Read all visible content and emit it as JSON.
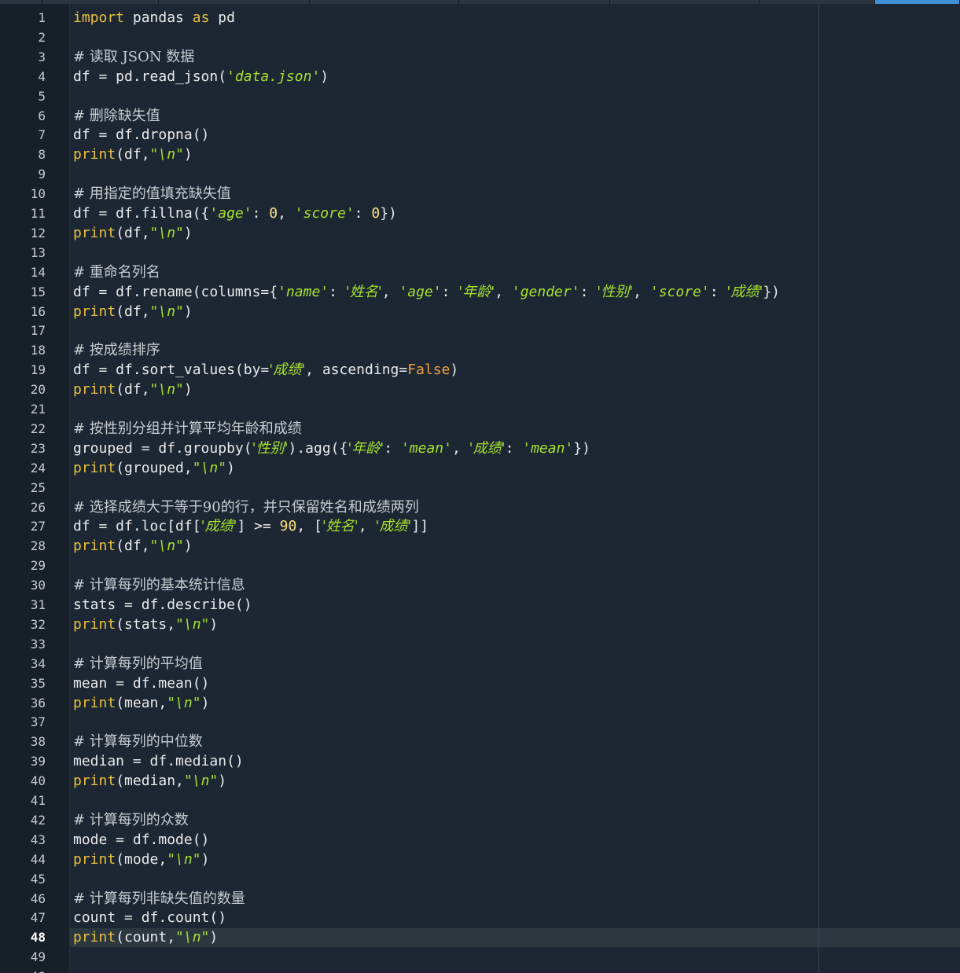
{
  "editor": {
    "current_line_label": "48",
    "gutter_numbers": [
      "1",
      "2",
      "3",
      "4",
      "5",
      "6",
      "7",
      "8",
      "9",
      "10",
      "11",
      "12",
      "13",
      "14",
      "15",
      "16",
      "17",
      "18",
      "19",
      "20",
      "21",
      "22",
      "23",
      "24",
      "25",
      "26",
      "27",
      "28",
      "29",
      "30",
      "31",
      "32",
      "33",
      "34",
      "35",
      "36",
      "37",
      "38",
      "39",
      "40",
      "41",
      "42",
      "43",
      "44",
      "45",
      "46",
      "47",
      "48",
      "49",
      "48"
    ],
    "colors": {
      "background": "#1c2733",
      "gutter": "#172029",
      "keyword": "#e8c040",
      "string": "#a6e22e",
      "comment": "#c8ccd0",
      "bool": "#f0a040",
      "current_line": "#2c3740"
    },
    "lines": [
      [
        [
          "kw",
          "import"
        ],
        [
          "p",
          " pandas "
        ],
        [
          "kw",
          "as"
        ],
        [
          "p",
          " pd"
        ]
      ],
      [],
      [
        [
          "com",
          "# 读取 JSON 数据"
        ]
      ],
      [
        [
          "p",
          "df = pd.read_json("
        ],
        [
          "str",
          "'data.json'"
        ],
        [
          "p",
          ")"
        ]
      ],
      [],
      [
        [
          "com",
          "# 删除缺失值"
        ]
      ],
      [
        [
          "p",
          "df = df.dropna()"
        ]
      ],
      [
        [
          "kw",
          "print"
        ],
        [
          "p",
          "(df,"
        ],
        [
          "str",
          "\"\\n\""
        ],
        [
          "p",
          ")"
        ]
      ],
      [],
      [
        [
          "com",
          "# 用指定的值填充缺失值"
        ]
      ],
      [
        [
          "p",
          "df = df.fillna({"
        ],
        [
          "str",
          "'age'"
        ],
        [
          "p",
          ": "
        ],
        [
          "num",
          "0"
        ],
        [
          "p",
          ", "
        ],
        [
          "str",
          "'score'"
        ],
        [
          "p",
          ": "
        ],
        [
          "num",
          "0"
        ],
        [
          "p",
          "})"
        ]
      ],
      [
        [
          "kw",
          "print"
        ],
        [
          "p",
          "(df,"
        ],
        [
          "str",
          "\"\\n\""
        ],
        [
          "p",
          ")"
        ]
      ],
      [],
      [
        [
          "com",
          "# 重命名列名"
        ]
      ],
      [
        [
          "p",
          "df = df.rename(columns={"
        ],
        [
          "str",
          "'name'"
        ],
        [
          "p",
          ": "
        ],
        [
          "str",
          "'姓名'"
        ],
        [
          "p",
          ", "
        ],
        [
          "str",
          "'age'"
        ],
        [
          "p",
          ": "
        ],
        [
          "str",
          "'年龄'"
        ],
        [
          "p",
          ", "
        ],
        [
          "str",
          "'gender'"
        ],
        [
          "p",
          ": "
        ],
        [
          "str",
          "'性别'"
        ],
        [
          "p",
          ", "
        ],
        [
          "str",
          "'score'"
        ],
        [
          "p",
          ": "
        ],
        [
          "str",
          "'成绩'"
        ],
        [
          "p",
          "})"
        ]
      ],
      [
        [
          "kw",
          "print"
        ],
        [
          "p",
          "(df,"
        ],
        [
          "str",
          "\"\\n\""
        ],
        [
          "p",
          ")"
        ]
      ],
      [],
      [
        [
          "com",
          "# 按成绩排序"
        ]
      ],
      [
        [
          "p",
          "df = df.sort_values(by="
        ],
        [
          "str",
          "'成绩'"
        ],
        [
          "p",
          ", ascending="
        ],
        [
          "bool",
          "False"
        ],
        [
          "p",
          ")"
        ]
      ],
      [
        [
          "kw",
          "print"
        ],
        [
          "p",
          "(df,"
        ],
        [
          "str",
          "\"\\n\""
        ],
        [
          "p",
          ")"
        ]
      ],
      [],
      [
        [
          "com",
          "# 按性别分组并计算平均年龄和成绩"
        ]
      ],
      [
        [
          "p",
          "grouped = df.groupby("
        ],
        [
          "str",
          "'性别'"
        ],
        [
          "p",
          ").agg({"
        ],
        [
          "str",
          "'年龄'"
        ],
        [
          "p",
          ": "
        ],
        [
          "str",
          "'mean'"
        ],
        [
          "p",
          ", "
        ],
        [
          "str",
          "'成绩'"
        ],
        [
          "p",
          ": "
        ],
        [
          "str",
          "'mean'"
        ],
        [
          "p",
          "})"
        ]
      ],
      [
        [
          "kw",
          "print"
        ],
        [
          "p",
          "(grouped,"
        ],
        [
          "str",
          "\"\\n\""
        ],
        [
          "p",
          ")"
        ]
      ],
      [],
      [
        [
          "com",
          "# 选择成绩大于等于90的行，并只保留姓名和成绩两列"
        ]
      ],
      [
        [
          "p",
          "df = df.loc[df["
        ],
        [
          "str",
          "'成绩'"
        ],
        [
          "p",
          "] >= "
        ],
        [
          "num",
          "90"
        ],
        [
          "p",
          ", ["
        ],
        [
          "str",
          "'姓名'"
        ],
        [
          "p",
          ", "
        ],
        [
          "str",
          "'成绩'"
        ],
        [
          "p",
          "]]"
        ]
      ],
      [
        [
          "kw",
          "print"
        ],
        [
          "p",
          "(df,"
        ],
        [
          "str",
          "\"\\n\""
        ],
        [
          "p",
          ")"
        ]
      ],
      [],
      [
        [
          "com",
          "# 计算每列的基本统计信息"
        ]
      ],
      [
        [
          "p",
          "stats = df.describe()"
        ]
      ],
      [
        [
          "kw",
          "print"
        ],
        [
          "p",
          "(stats,"
        ],
        [
          "str",
          "\"\\n\""
        ],
        [
          "p",
          ")"
        ]
      ],
      [],
      [
        [
          "com",
          "# 计算每列的平均值"
        ]
      ],
      [
        [
          "p",
          "mean = df.mean()"
        ]
      ],
      [
        [
          "kw",
          "print"
        ],
        [
          "p",
          "(mean,"
        ],
        [
          "str",
          "\"\\n\""
        ],
        [
          "p",
          ")"
        ]
      ],
      [],
      [
        [
          "com",
          "# 计算每列的中位数"
        ]
      ],
      [
        [
          "p",
          "median = df.median()"
        ]
      ],
      [
        [
          "kw",
          "print"
        ],
        [
          "p",
          "(median,"
        ],
        [
          "str",
          "\"\\n\""
        ],
        [
          "p",
          ")"
        ]
      ],
      [],
      [
        [
          "com",
          "# 计算每列的众数"
        ]
      ],
      [
        [
          "p",
          "mode = df.mode()"
        ]
      ],
      [
        [
          "kw",
          "print"
        ],
        [
          "p",
          "(mode,"
        ],
        [
          "str",
          "\"\\n\""
        ],
        [
          "p",
          ")"
        ]
      ],
      [],
      [
        [
          "com",
          "# 计算每列非缺失值的数量"
        ]
      ],
      [
        [
          "p",
          "count = df.count()"
        ]
      ],
      [
        [
          "kw",
          "print"
        ],
        [
          "p",
          "(count,"
        ],
        [
          "str",
          "\"\\n\""
        ],
        [
          "p",
          ")"
        ]
      ]
    ]
  }
}
